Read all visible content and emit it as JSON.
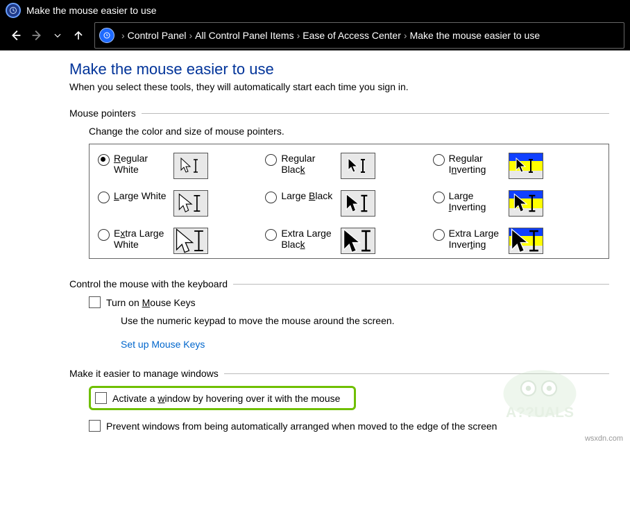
{
  "window": {
    "title": "Make the mouse easier to use"
  },
  "breadcrumb": [
    "Control Panel",
    "All Control Panel Items",
    "Ease of Access Center",
    "Make the mouse easier to use"
  ],
  "page": {
    "heading": "Make the mouse easier to use",
    "subtitle": "When you select these tools, they will automatically start each time you sign in."
  },
  "mouse_pointers": {
    "section_label": "Mouse pointers",
    "desc": "Change the color and size of mouse pointers.",
    "options": {
      "regular_white": "Regular White",
      "regular_black": "Regular Black",
      "regular_inverting": "Regular Inverting",
      "large_white": "Large White",
      "large_black": "Large Black",
      "large_inverting": "Large Inverting",
      "xl_white": "Extra Large White",
      "xl_black": "Extra Large Black",
      "xl_inverting": "Extra Large Inverting"
    },
    "selected": "regular_white"
  },
  "keyboard": {
    "section_label": "Control the mouse with the keyboard",
    "mouse_keys_label": "Turn on Mouse Keys",
    "mouse_keys_checked": false,
    "help": "Use the numeric keypad to move the mouse around the screen.",
    "setup_link": "Set up Mouse Keys"
  },
  "windows": {
    "section_label": "Make it easier to manage windows",
    "hover_label": "Activate a window by hovering over it with the mouse",
    "hover_checked": false,
    "snap_label": "Prevent windows from being automatically arranged when moved to the edge of the screen",
    "snap_checked": false
  },
  "watermark": "wsxdn.com"
}
